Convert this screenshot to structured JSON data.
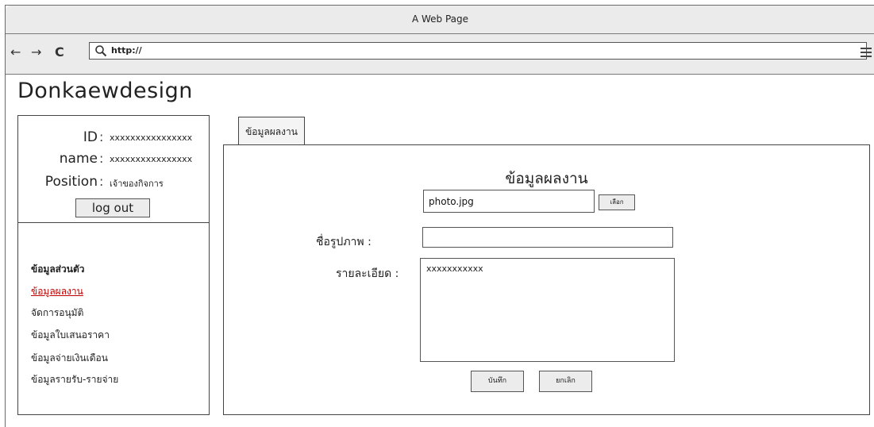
{
  "window": {
    "title": "A Web Page"
  },
  "browser": {
    "back_icon": "←",
    "forward_icon": "→",
    "reload_icon": "C",
    "url": "http://"
  },
  "brand": "Donkaewdesign",
  "user": {
    "id_label": "ID",
    "id_value": "xxxxxxxxxxxxxxxx",
    "name_label": "name",
    "name_value": "xxxxxxxxxxxxxxxx",
    "position_label": "Position",
    "position_value": "เจ้าของกิจการ",
    "colon": ":",
    "logout_label": "log out"
  },
  "sidebar": {
    "items": [
      {
        "label": "ข้อมูลส่วนตัว",
        "active": false
      },
      {
        "label": "ข้อมูลผลงาน",
        "active": true
      },
      {
        "label": "จัดการอนุมัติ",
        "active": false
      },
      {
        "label": "ข้อมูลใบเสนอราคา",
        "active": false
      },
      {
        "label": "ข้อมูลจ่ายเงินเดือน",
        "active": false
      },
      {
        "label": "ข้อมูลรายรับ-รายจ่าย",
        "active": false
      }
    ]
  },
  "tab": {
    "label": "ข้อมูลผลงาน"
  },
  "form": {
    "heading": "ข้อมูลผลงาน",
    "file_value": "photo.jpg",
    "browse_label": "เลือก",
    "image_name_label": "ชื่อรูปภาพ :",
    "image_name_value": "",
    "detail_label": "รายละเอียด :",
    "detail_value": "xxxxxxxxxxx",
    "save_label": "บันทึก",
    "cancel_label": "ยกเลิก"
  }
}
